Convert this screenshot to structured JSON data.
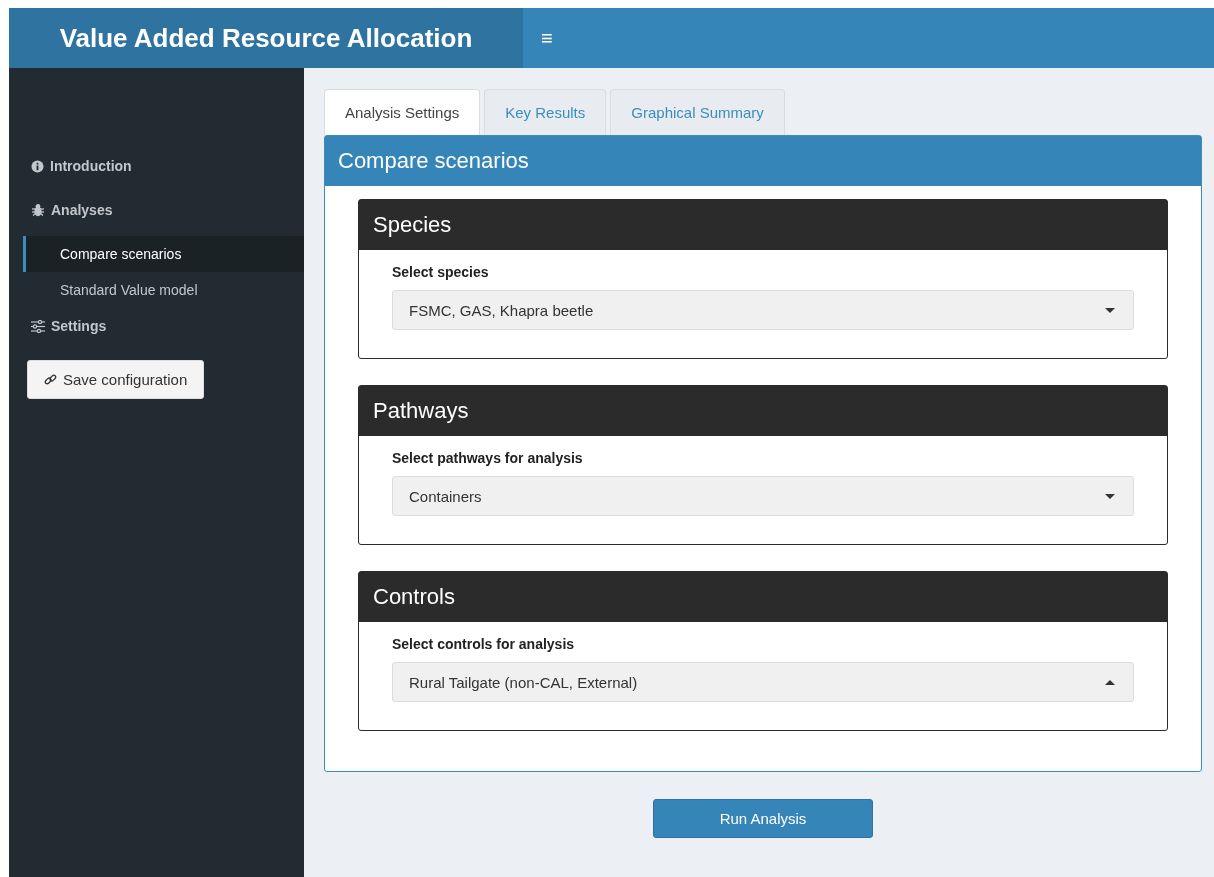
{
  "header": {
    "title": "Value Added Resource Allocation",
    "menu_icon": "≡"
  },
  "sidebar": {
    "items": [
      {
        "kind": "section",
        "label": "Introduction"
      },
      {
        "kind": "section",
        "label": "Analyses"
      },
      {
        "kind": "sub",
        "label": "Compare scenarios",
        "selected": true
      },
      {
        "kind": "sub",
        "label": "Standard Value model",
        "selected": false
      },
      {
        "kind": "section",
        "label": "Settings"
      }
    ],
    "save_button": "Save configuration"
  },
  "tabs": [
    {
      "label": "Analysis Settings",
      "selected": true
    },
    {
      "label": "Key Results",
      "selected": false
    },
    {
      "label": "Graphical Summary",
      "selected": false
    }
  ],
  "box": {
    "title": "Compare scenarios",
    "panels": [
      {
        "title": "Species",
        "label": "Select species",
        "value": "FSMC, GAS, Khapra beetle",
        "expanded": false
      },
      {
        "title": "Pathways",
        "label": "Select pathways for analysis",
        "value": "Containers",
        "expanded": false
      },
      {
        "title": "Controls",
        "label": "Select controls for analysis",
        "value": "Rural Tailgate (non-CAL, External)",
        "expanded": true
      }
    ]
  },
  "run_button": "Run Analysis"
}
